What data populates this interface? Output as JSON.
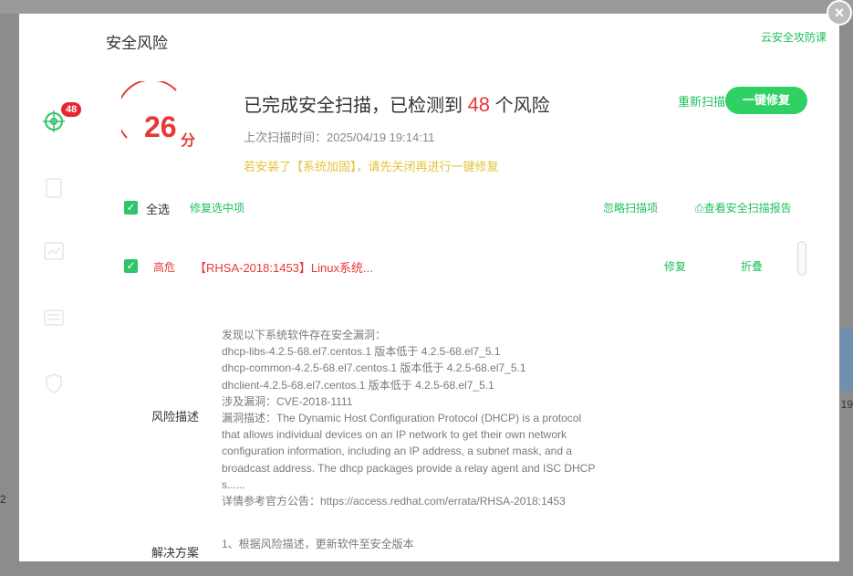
{
  "modal": {
    "title": "安全风险",
    "top_link": "云安全攻防课",
    "close_icon": "close-icon"
  },
  "sidebar": {
    "badge": "48",
    "icons": [
      "target-icon",
      "document-icon",
      "chart-icon",
      "list-icon",
      "shield-icon"
    ]
  },
  "score": {
    "value": "26",
    "unit": "分"
  },
  "summary": {
    "headline_pre": "已完成安全扫描，已检测到",
    "risk_count": "48",
    "headline_post": "个风险",
    "scan_time": "上次扫描时间：2025/04/19 19:14:11",
    "warning": "若安装了【系统加固】，请先关闭再进行一键修复"
  },
  "actions": {
    "rescan": "重新扫描",
    "fix_all": "一键修复"
  },
  "toolbar": {
    "select_all": "全选",
    "fix_selected": "修复选中项",
    "ignore_scan": "忽略扫描项",
    "view_report": "查看安全扫描报告"
  },
  "risk_row": {
    "level": "高危",
    "title": "【RHSA-2018:1453】Linux系统...",
    "fix": "修复",
    "fold": "折叠"
  },
  "description": {
    "label": "风险描述",
    "lines": [
      "发现以下系统软件存在安全漏洞：",
      "dhcp-libs-4.2.5-68.el7.centos.1 版本低于 4.2.5-68.el7_5.1",
      "dhcp-common-4.2.5-68.el7.centos.1 版本低于 4.2.5-68.el7_5.1",
      "dhclient-4.2.5-68.el7.centos.1 版本低于 4.2.5-68.el7_5.1",
      "涉及漏洞：CVE-2018-1111",
      "漏洞描述：The Dynamic Host Configuration Protocol (DHCP) is a protocol",
      "that allows individual devices on an IP network to get their own network",
      "configuration information, including an IP address, a subnet mask, and a",
      "broadcast address. The dhcp packages provide a relay agent and ISC DHCP",
      "s......",
      "详情参考官方公告：https://access.redhat.com/errata/RHSA-2018:1453"
    ]
  },
  "solution": {
    "label": "解决方案",
    "text": "1、根据风险描述，更新软件至安全版本"
  },
  "background": {
    "right_num": "19",
    "left_num": "2"
  },
  "colors": {
    "accent": "#2fd165",
    "danger": "#e53936",
    "warning": "#e3c33b"
  }
}
